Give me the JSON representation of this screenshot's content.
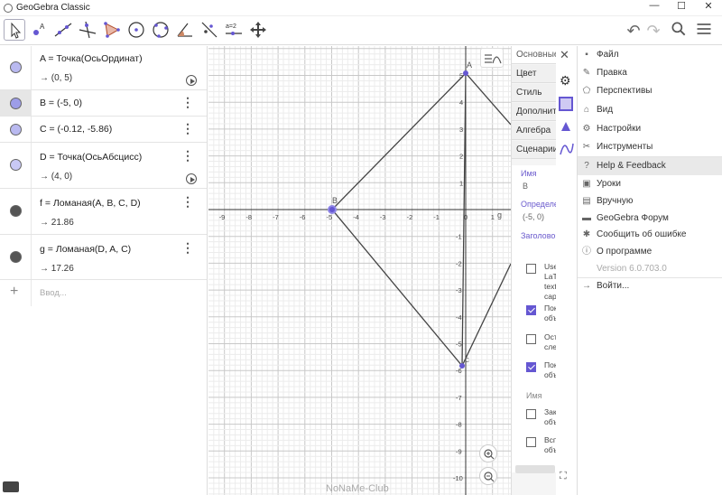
{
  "window": {
    "title": "GeoGebra Classic",
    "minimize": "—",
    "maximize": "☐",
    "close": "✕"
  },
  "toolbar": {
    "tools": [
      "move",
      "point",
      "line",
      "perpendicular-line",
      "polygon",
      "circle-center-point",
      "circle-3-points",
      "angle",
      "reflect",
      "slider",
      "move-graphics-view"
    ],
    "slider_label": "a=2"
  },
  "algebra": {
    "rows": [
      {
        "def": "A = Точка(ОсьОрдинат)",
        "value": "→ (0, 5)",
        "color": "#b9b9f0",
        "has_play": true
      },
      {
        "def": "B = (-5, 0)",
        "value": "",
        "color": "#9d9de8",
        "selected": true
      },
      {
        "def": "C = (-0.12, -5.86)",
        "value": "",
        "color": "#b9b9f0"
      },
      {
        "def": "D = Точка(ОсьАбсцисс)",
        "value": "→ (4, 0)",
        "color": "#c9c9f5",
        "has_play": true
      },
      {
        "def": "f = Ломаная(A, B, C, D)",
        "value": "→ 21.86",
        "color": "#555555"
      },
      {
        "def": "g = Ломаная(D, A, C)",
        "value": "→ 17.26",
        "color": "#555555"
      }
    ],
    "input_placeholder": "Ввод..."
  },
  "graphics": {
    "x_ticks": [
      "-9",
      "-8",
      "-7",
      "-6",
      "-5",
      "-4",
      "-3",
      "-2",
      "-1",
      "0",
      "1"
    ],
    "y_ticks": [
      "5",
      "4",
      "3",
      "2",
      "1",
      "-1",
      "-2",
      "-3",
      "-4",
      "-5",
      "-6",
      "-7",
      "-8",
      "-9",
      "-10"
    ],
    "point_labels": {
      "A": "A",
      "B": "B",
      "C": "C",
      "axis_g": "g"
    },
    "watermark": "NoNaMe-Club"
  },
  "properties": {
    "tabs": [
      "Основные",
      "Цвет",
      "Стиль",
      "Дополнительно",
      "Алгебра",
      "Сценарии"
    ],
    "name_label": "Имя",
    "name_value": "B",
    "definition_label": "Определение",
    "definition_value": "(-5, 0)",
    "caption_label": "Заголовок",
    "checkboxes": [
      {
        "text": "Use LaTeX text caption",
        "checked": false
      },
      {
        "text": "Показывать объект",
        "checked": true
      },
      {
        "text": "Оставлять след",
        "checked": false
      },
      {
        "text": "Показывать объект",
        "checked": true
      }
    ],
    "name_label2": "Имя",
    "checkboxes2": [
      {
        "text": "Закрепить объект",
        "checked": false
      },
      {
        "text": "Вспомогательный объект",
        "checked": false
      }
    ]
  },
  "menu": {
    "items": [
      {
        "label": "Файл",
        "icon": "file-icon"
      },
      {
        "label": "Правка",
        "icon": "edit-icon"
      },
      {
        "label": "Перспективы",
        "icon": "perspectives-icon"
      },
      {
        "label": "Вид",
        "icon": "view-icon"
      },
      {
        "label": "Настройки",
        "icon": "settings-icon"
      },
      {
        "label": "Инструменты",
        "icon": "tools-icon"
      },
      {
        "label": "Help & Feedback",
        "icon": "help-icon"
      },
      {
        "label": "Уроки",
        "icon": "tutorials-icon"
      },
      {
        "label": "Вручную",
        "icon": "manual-icon"
      },
      {
        "label": "GeoGebra Форум",
        "icon": "forum-icon"
      },
      {
        "label": "Сообщить об ошибке",
        "icon": "bug-icon"
      },
      {
        "label": "О программе",
        "icon": "info-icon"
      },
      {
        "label": "Version 6.0.703.0",
        "icon": ""
      },
      {
        "label": "Войти...",
        "icon": "signin-icon"
      }
    ]
  }
}
